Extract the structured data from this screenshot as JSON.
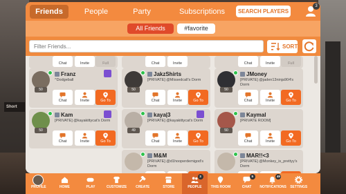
{
  "world": {
    "sign_text": "Short"
  },
  "tabs": [
    "Friends",
    "People",
    "Party",
    "Subscriptions"
  ],
  "header": {
    "search_label": "SEARCH PLAYERS",
    "notification_count": "3"
  },
  "filters": {
    "all_label": "All Friends",
    "favorite_label": "#favorite"
  },
  "filterbar": {
    "placeholder": "Filter Friends...",
    "sort_label": "SORT"
  },
  "buttons": {
    "chat": "Chat",
    "invite": "Invite",
    "goto": "Go To"
  },
  "friends": [
    {
      "name": "Franz",
      "status": "^Dodgeball",
      "level": "50",
      "online": true,
      "plus": true
    },
    {
      "name": "JakzShirts",
      "status": "[PRIVATE] @Missedcall's Dorm",
      "level": "50",
      "online": true,
      "plus": false
    },
    {
      "name": "JMoney",
      "status": "[PRIVATE] @jaden13ninja904's Dorm",
      "level": "50",
      "online": true,
      "plus": false
    },
    {
      "name": "Kam",
      "status": "[PRIVATE] @kayakittycat's Dorm",
      "level": "50",
      "online": true,
      "plus": true
    },
    {
      "name": "kaya|3",
      "status": "[PRIVATE] @kayakittycat's Dorm",
      "level": "49",
      "online": true,
      "plus": true
    },
    {
      "name": "Kaymal",
      "status": "[PRIVATE ROOM]",
      "level": "50",
      "online": true,
      "plus": false
    },
    {
      "name": "M&M",
      "status": "[PRIVATE] @d1hooperdemigod's Dorm",
      "level": "",
      "online": true,
      "plus": false
    },
    {
      "name": "MAR!!<3",
      "status": "[PRIVATE] @Monkey_is_prettyy's Dorm",
      "level": "",
      "online": true,
      "plus": false
    }
  ],
  "nav": [
    {
      "label": "PROFILE",
      "icon": "avatar",
      "badge": ""
    },
    {
      "label": "HOME",
      "icon": "home-icon",
      "badge": ""
    },
    {
      "label": "PLAY",
      "icon": "gamepad-icon",
      "badge": ""
    },
    {
      "label": "CUSTOMIZE",
      "icon": "shirt-icon",
      "badge": ""
    },
    {
      "label": "CREATE",
      "icon": "hammer-icon",
      "badge": ""
    },
    {
      "label": "STORE",
      "icon": "store-icon",
      "badge": ""
    },
    {
      "label": "PEOPLE",
      "icon": "people-icon",
      "badge": "3"
    },
    {
      "label": "THIS ROOM",
      "icon": "location-icon",
      "badge": ""
    },
    {
      "label": "CHAT",
      "icon": "chat-icon",
      "badge": "5"
    },
    {
      "label": "NOTIFICATIONS",
      "icon": "bell-icon",
      "badge": "49"
    },
    {
      "label": "SETTINGS",
      "icon": "gear-icon",
      "badge": ""
    }
  ],
  "colors": {
    "accent": "#f38a3f",
    "goto": "#f26a22",
    "online": "#2fc24c",
    "plus": "#7b4fd1"
  }
}
